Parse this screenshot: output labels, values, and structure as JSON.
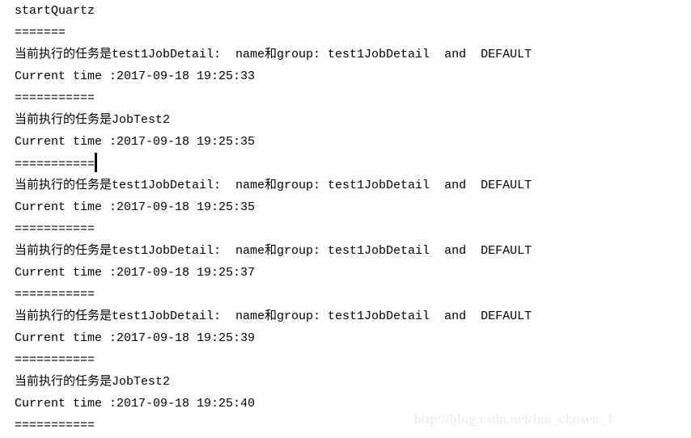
{
  "console": {
    "title": "startQuartz",
    "background_color": "#ffffff",
    "text_color": "#000000",
    "lines": [
      {
        "text": "startQuartz",
        "kind": "text",
        "caret": false
      },
      {
        "text": "=======",
        "kind": "separator",
        "caret": false
      },
      {
        "text": "当前执行的任务是test1JobDetail:  name和group: test1JobDetail  and  DEFAULT",
        "kind": "text",
        "caret": false
      },
      {
        "text": "Current time :2017-09-18 19:25:33",
        "kind": "text",
        "caret": false
      },
      {
        "text": "===========",
        "kind": "separator",
        "caret": false
      },
      {
        "text": "当前执行的任务是JobTest2",
        "kind": "text",
        "caret": false
      },
      {
        "text": "Current time :2017-09-18 19:25:35",
        "kind": "text",
        "caret": false
      },
      {
        "text": "===========",
        "kind": "separator",
        "caret": true
      },
      {
        "text": "当前执行的任务是test1JobDetail:  name和group: test1JobDetail  and  DEFAULT",
        "kind": "text",
        "caret": false
      },
      {
        "text": "Current time :2017-09-18 19:25:35",
        "kind": "text",
        "caret": false
      },
      {
        "text": "===========",
        "kind": "separator",
        "caret": false
      },
      {
        "text": "当前执行的任务是test1JobDetail:  name和group: test1JobDetail  and  DEFAULT",
        "kind": "text",
        "caret": false
      },
      {
        "text": "Current time :2017-09-18 19:25:37",
        "kind": "text",
        "caret": false
      },
      {
        "text": "===========",
        "kind": "separator",
        "caret": false
      },
      {
        "text": "当前执行的任务是test1JobDetail:  name和group: test1JobDetail  and  DEFAULT",
        "kind": "text",
        "caret": false
      },
      {
        "text": "Current time :2017-09-18 19:25:39",
        "kind": "text",
        "caret": false
      },
      {
        "text": "===========",
        "kind": "separator",
        "caret": false
      },
      {
        "text": "当前执行的任务是JobTest2",
        "kind": "text",
        "caret": false
      },
      {
        "text": "Current time :2017-09-18 19:25:40",
        "kind": "text",
        "caret": false
      },
      {
        "text": "===========",
        "kind": "separator",
        "caret": false
      }
    ]
  },
  "watermark": {
    "text": "http://blog.csdn.net/luo_chosen_1",
    "color": "#e9e9e9"
  }
}
